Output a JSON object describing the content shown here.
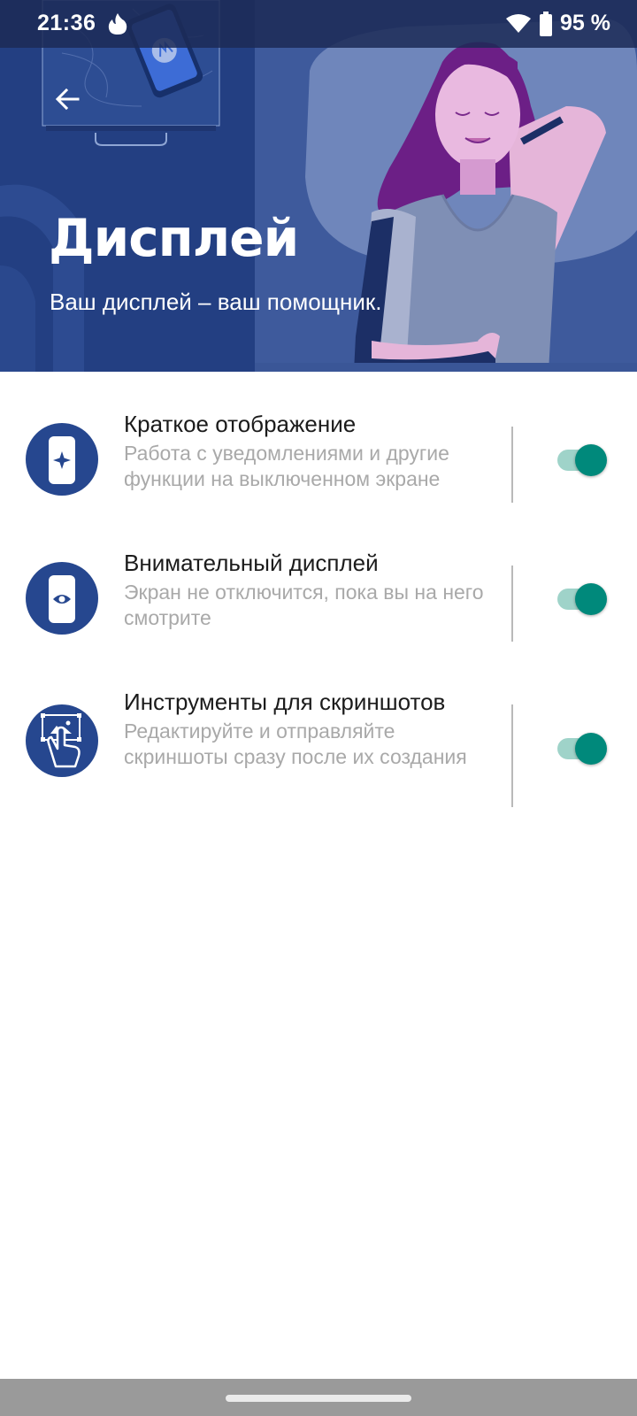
{
  "status_bar": {
    "time": "21:36",
    "battery": "95 %",
    "icons": [
      "flame-icon",
      "wifi-icon",
      "battery-icon"
    ]
  },
  "header": {
    "back_icon": "arrow-left-icon",
    "title": "Дисплей",
    "subtitle": "Ваш дисплей – ваш помощник."
  },
  "settings": [
    {
      "icon": "phone-sparkle-icon",
      "title": "Краткое отображение",
      "summary": "Работа с уведомлениями и другие функции на выключенном экране",
      "enabled": true
    },
    {
      "icon": "phone-eye-icon",
      "title": "Внимательный дисплей",
      "summary": "Экран не отключится, пока вы на него смотрите",
      "enabled": true
    },
    {
      "icon": "screenshot-hand-icon",
      "title": "Инструменты для скриншотов",
      "summary": "Редактируйте и отправляйте скриншоты сразу после их создания",
      "enabled": true
    }
  ],
  "colors": {
    "hero_blue": "#2c4a8e",
    "icon_circle": "#26478f",
    "toggle_thumb": "#00897b",
    "toggle_track": "#9fd3c9",
    "summary_gray": "#a9a9a9"
  }
}
